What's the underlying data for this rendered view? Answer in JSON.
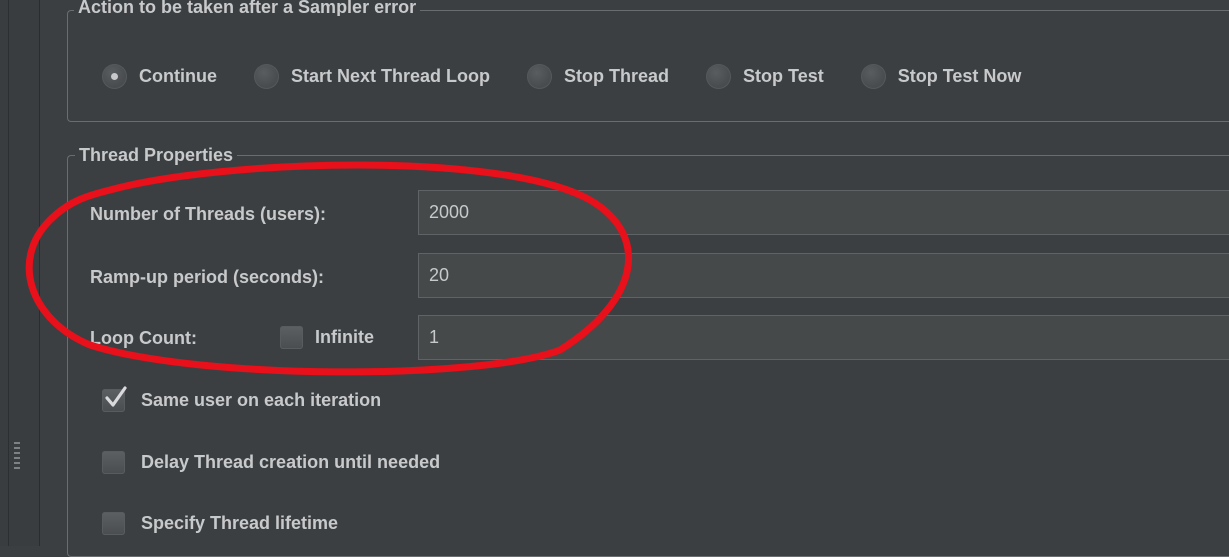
{
  "sampler_error": {
    "legend": "Action to be taken after a Sampler error",
    "options": [
      {
        "label": "Continue",
        "selected": true
      },
      {
        "label": "Start Next Thread Loop",
        "selected": false
      },
      {
        "label": "Stop Thread",
        "selected": false
      },
      {
        "label": "Stop Test",
        "selected": false
      },
      {
        "label": "Stop Test Now",
        "selected": false
      }
    ]
  },
  "thread_properties": {
    "legend": "Thread Properties",
    "num_threads": {
      "label": "Number of Threads (users):",
      "value": "2000"
    },
    "ramp_up": {
      "label": "Ramp-up period (seconds):",
      "value": "20"
    },
    "loop_count": {
      "label": "Loop Count:",
      "infinite_label": "Infinite",
      "infinite_checked": false,
      "value": "1"
    }
  },
  "options": {
    "same_user": {
      "label": "Same user on each iteration",
      "checked": true
    },
    "delay_creation": {
      "label": "Delay Thread creation until needed",
      "checked": false
    },
    "specify_lifetime": {
      "label": "Specify Thread lifetime",
      "checked": false
    }
  },
  "annotation": {
    "color": "#e8101a"
  },
  "colors": {
    "background": "#3c3f41",
    "text": "#c7c9cb",
    "field": "#45494a"
  }
}
